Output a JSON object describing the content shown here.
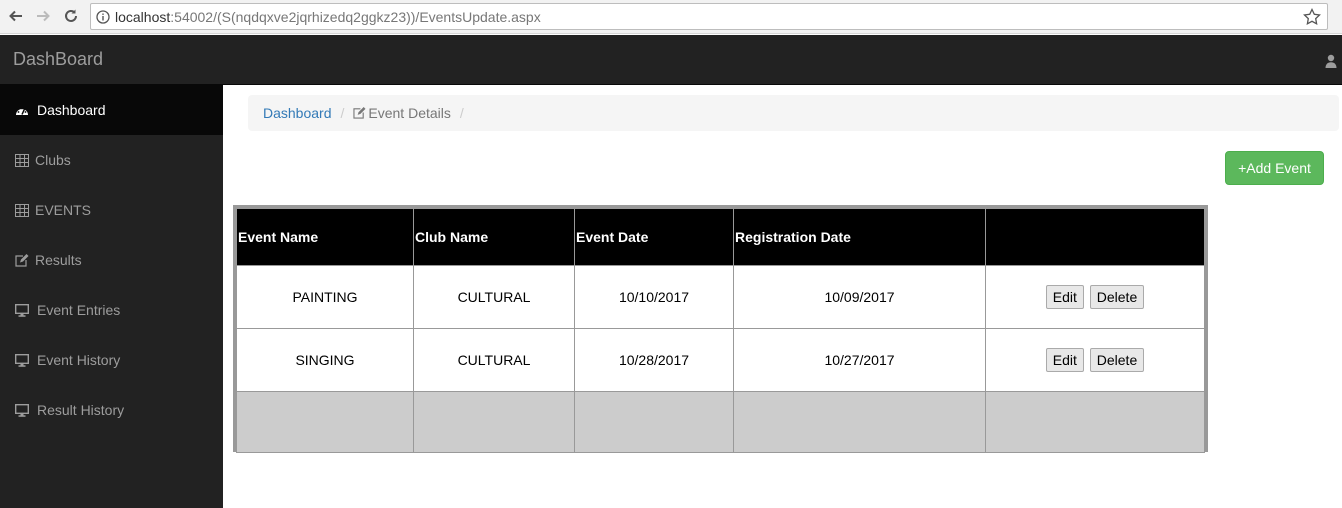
{
  "browser": {
    "url_host": "localhost",
    "url_rest": ":54002/(S(nqdqxve2jqrhizedq2ggkz23))/EventsUpdate.aspx"
  },
  "navbar": {
    "brand": "DashBoard",
    "user_icon": "user-icon"
  },
  "sidebar": {
    "items": [
      {
        "label": "Dashboard",
        "icon": "dashboard-icon",
        "active": true
      },
      {
        "label": "Clubs",
        "icon": "table-icon"
      },
      {
        "label": "EVENTS",
        "icon": "table-icon"
      },
      {
        "label": "Results",
        "icon": "edit-icon"
      },
      {
        "label": "Event Entries",
        "icon": "desktop-icon"
      },
      {
        "label": "Event History",
        "icon": "desktop-icon"
      },
      {
        "label": "Result History",
        "icon": "desktop-icon"
      }
    ]
  },
  "breadcrumb": {
    "home": "Dashboard",
    "current": "Event Details",
    "separator": "/"
  },
  "add_button": "+Add Event",
  "grid": {
    "headers": [
      "Event Name",
      "Club Name",
      "Event Date",
      "Registration Date",
      ""
    ],
    "rows": [
      {
        "event_name": "PAINTING",
        "club_name": "CULTURAL",
        "event_date": "10/10/2017",
        "registration_date": "10/09/2017",
        "edit": "Edit",
        "delete": "Delete"
      },
      {
        "event_name": "SINGING",
        "club_name": "CULTURAL",
        "event_date": "10/28/2017",
        "registration_date": "10/27/2017",
        "edit": "Edit",
        "delete": "Delete"
      }
    ]
  },
  "colors": {
    "navbar": "#222222",
    "active_item": "#080808",
    "accent_link": "#337ab7",
    "add_button": "#5cb85c",
    "header_bg": "#000000"
  }
}
